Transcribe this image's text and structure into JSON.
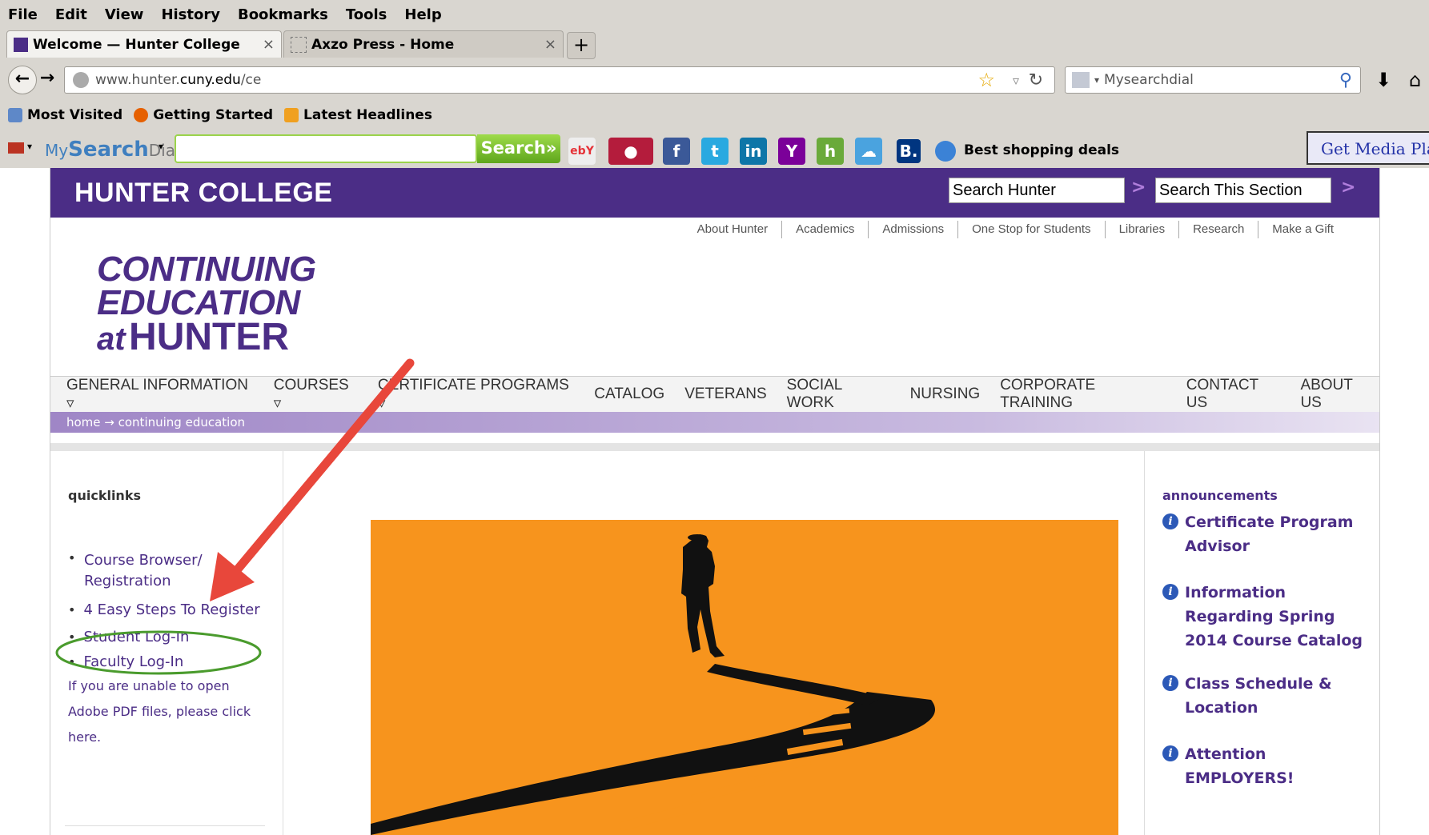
{
  "menubar": [
    "File",
    "Edit",
    "View",
    "History",
    "Bookmarks",
    "Tools",
    "Help"
  ],
  "tabs": [
    {
      "title": "Welcome — Hunter College",
      "close": "×"
    },
    {
      "title": "Axzo Press - Home",
      "close": "×"
    }
  ],
  "newtab": "+",
  "url": {
    "pre": "www.hunter.",
    "bold": "cuny.edu",
    "post": "/ce"
  },
  "search_engine": "Mysearchdial",
  "bookmarks": [
    "Most Visited",
    "Getting Started",
    "Latest Headlines"
  ],
  "toolbar": {
    "brand_my": "My",
    "brand_search": "Search",
    "brand_dial": "Dial",
    "search_btn": "Search»",
    "best_deals": "Best shopping deals",
    "get_media": "Get Media Play",
    "b_label": "B."
  },
  "site": {
    "logo": "HUNTER COLLEGE",
    "search_hunter": "Search Hunter",
    "search_section": "Search This Section",
    "go": ">",
    "toplinks": [
      "About Hunter",
      "Academics",
      "Admissions",
      "One Stop for Students",
      "Libraries",
      "Research",
      "Make a Gift"
    ],
    "ce_line1": "CONTINUING",
    "ce_line2": "EDUCATION",
    "ce_at": "at",
    "ce_hunter": "HUNTER",
    "nav": [
      "GENERAL INFORMATION ▿",
      "COURSES ▿",
      "CERTIFICATE PROGRAMS ▿",
      "CATALOG",
      "VETERANS",
      "SOCIAL WORK",
      "NURSING",
      "CORPORATE TRAINING",
      "CONTACT US",
      "ABOUT US"
    ],
    "breadcrumb": "home → continuing education",
    "quicklinks_title": "quicklinks",
    "quicklinks": [
      "Course Browser/ Registration",
      "4 Easy Steps To Register",
      "Student Log-In",
      "Faculty Log-In"
    ],
    "pdf_note": "If you are unable to open Adobe PDF files, please click here.",
    "announcements_title": "announcements",
    "announcements": [
      "Certificate Program Advisor",
      "Information Regarding Spring 2014 Course Catalog",
      "Class Schedule & Location",
      "Attention EMPLOYERS!"
    ]
  },
  "colors": {
    "purple": "#4b2d86",
    "orange": "#f7941d",
    "arrow": "#e8473b",
    "circle": "#4a9b2d"
  }
}
